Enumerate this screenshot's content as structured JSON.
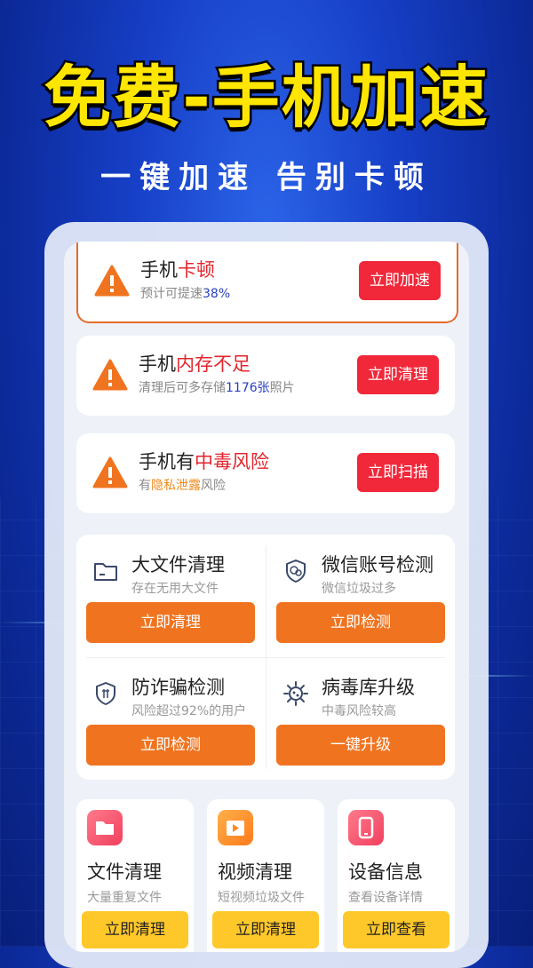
{
  "banner": {
    "headline": "免费-手机加速",
    "subline": "一键加速 告别卡顿"
  },
  "alerts": [
    {
      "title_prefix": "手机",
      "title_highlight": "卡顿",
      "sub_prefix": "预计可提速",
      "sub_highlight": "38%",
      "sub_suffix": "",
      "button": "立即加速"
    },
    {
      "title_prefix": "手机",
      "title_highlight": "内存不足",
      "sub_prefix": "清理后可多存储",
      "sub_highlight": "1176张",
      "sub_suffix": "照片",
      "button": "立即清理"
    },
    {
      "title_prefix": "手机有",
      "title_highlight": "中毒风险",
      "sub_prefix": "有",
      "sub_highlight": "隐私泄露",
      "sub_suffix": "风险",
      "button": "立即扫描"
    }
  ],
  "tools": [
    {
      "title": "大文件清理",
      "sub": "存在无用大文件",
      "button": "立即清理",
      "icon": "folder-icon"
    },
    {
      "title": "微信账号检测",
      "sub": "微信垃圾过多",
      "button": "立即检测",
      "icon": "wechat-shield-icon"
    },
    {
      "title": "防诈骗检测",
      "sub": "风险超过92%的用户",
      "button": "立即检测",
      "icon": "shield-icon"
    },
    {
      "title": "病毒库升级",
      "sub": "中毒风险较高",
      "button": "一键升级",
      "icon": "virus-icon"
    }
  ],
  "mini": [
    {
      "title": "文件清理",
      "sub": "大量重复文件",
      "button": "立即清理",
      "icon": "folder-icon"
    },
    {
      "title": "视频清理",
      "sub": "短视频垃圾文件",
      "button": "立即清理",
      "icon": "video-icon"
    },
    {
      "title": "设备信息",
      "sub": "查看设备详情",
      "button": "立即查看",
      "icon": "phone-icon"
    }
  ],
  "colors": {
    "headline": "#ffe600",
    "alert_button": "#f0283a",
    "tool_button": "#f07420",
    "mini_button": "#ffc82a",
    "mini_icon_1": "#f64b6b",
    "mini_icon_2": "#ff8a1e",
    "mini_icon_3": "#f2405e"
  }
}
